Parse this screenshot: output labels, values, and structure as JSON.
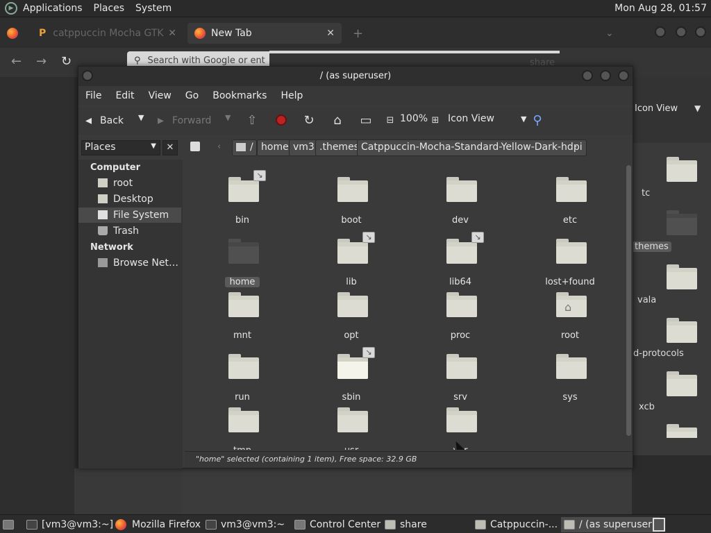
{
  "top_panel": {
    "menus": [
      "Applications",
      "Places",
      "System"
    ],
    "clock": "Mon Aug 28, 01:57"
  },
  "browser": {
    "tabs": [
      {
        "label": "catppuccin Mocha GTK The",
        "active": false
      },
      {
        "label": "New Tab",
        "active": true
      }
    ],
    "url_placeholder": "Search with Google or ent",
    "share_partial": "share"
  },
  "share_window": {
    "view_label": "Icon View",
    "labels": [
      "tc",
      "themes",
      "vala",
      "d-protocols",
      "xcb"
    ]
  },
  "window": {
    "title": "/ (as superuser)",
    "menu": [
      "File",
      "Edit",
      "View",
      "Go",
      "Bookmarks",
      "Help"
    ],
    "toolbar": {
      "back": "Back",
      "forward": "Forward",
      "zoom": "100%",
      "view_mode": "Icon View"
    },
    "side_pane_selector": "Places",
    "path": [
      "/",
      "home",
      "vm3",
      ".themes",
      "Catppuccin-Mocha-Standard-Yellow-Dark-hdpi"
    ],
    "sidebar": {
      "computer_heading": "Computer",
      "computer_items": [
        "root",
        "Desktop",
        "File System",
        "Trash"
      ],
      "network_heading": "Network",
      "network_items": [
        "Browse Net…"
      ],
      "selected": "File System"
    },
    "items": [
      {
        "name": "bin",
        "link": true
      },
      {
        "name": "boot"
      },
      {
        "name": "dev"
      },
      {
        "name": "etc"
      },
      {
        "name": "home",
        "selected": true
      },
      {
        "name": "lib",
        "link": true
      },
      {
        "name": "lib64",
        "link": true
      },
      {
        "name": "lost+found"
      },
      {
        "name": "mnt"
      },
      {
        "name": "opt"
      },
      {
        "name": "proc"
      },
      {
        "name": "root",
        "home_icon": true
      },
      {
        "name": "run"
      },
      {
        "name": "sbin",
        "link": true,
        "hover": true
      },
      {
        "name": "srv"
      },
      {
        "name": "sys"
      },
      {
        "name": "tmp"
      },
      {
        "name": "usr"
      },
      {
        "name": "var"
      }
    ],
    "status": "\"home\" selected (containing 1 item), Free space: 32.9 GB"
  },
  "taskbar": {
    "items": [
      "[vm3@vm3:~]",
      "Mozilla Firefox",
      "vm3@vm3:~",
      "Control Center",
      "share",
      "Catppuccin-...",
      "/ (as superuser)"
    ],
    "active": "/ (as superuser)"
  }
}
